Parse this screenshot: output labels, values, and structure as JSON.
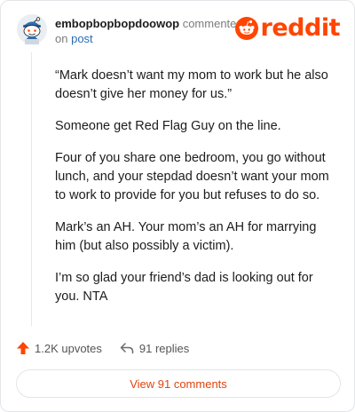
{
  "header": {
    "username": "embopbopbopdoowop",
    "action_text": "commented",
    "on_text": "on",
    "post_link": "post"
  },
  "brand": {
    "logo_text": "reddit",
    "accent_color": "#ff4500"
  },
  "comment": {
    "paragraphs": [
      "“Mark doesn’t want my mom to work but he also doesn’t give her money for us.”",
      "Someone get Red Flag Guy on the line.",
      "Four of you share one bedroom, you go without lunch, and your stepdad doesn’t want your mom to work to provide for you but refuses to do so.",
      "Mark’s an AH. Your mom’s an AH for marrying him (but also possibly a victim).",
      "I’m so glad your friend’s dad is looking out for you. NTA"
    ]
  },
  "footer": {
    "upvotes": "1.2K upvotes",
    "replies": "91 replies",
    "upvote_icon": "upvote-arrow-icon",
    "reply_icon": "reply-arrow-icon"
  },
  "view_button": {
    "label": "View 91 comments"
  }
}
